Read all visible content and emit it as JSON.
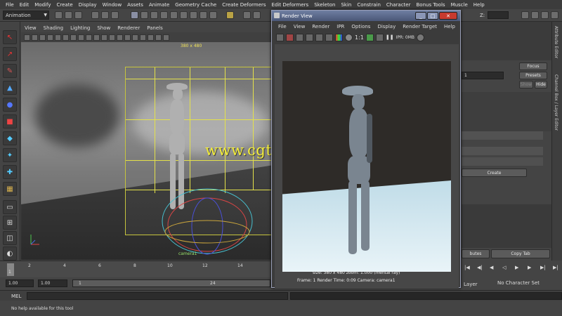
{
  "main_menu": [
    "File",
    "Edit",
    "Modify",
    "Create",
    "Display",
    "Window",
    "Assets",
    "Animate",
    "Geometry Cache",
    "Create Deformers",
    "Edit Deformers",
    "Skeleton",
    "Skin",
    "Constrain",
    "Character",
    "Bonus Tools",
    "Muscle",
    "Help"
  ],
  "status_line": {
    "mode": "Animation",
    "z_label": "Z:"
  },
  "viewport": {
    "menu": [
      "View",
      "Shading",
      "Lighting",
      "Show",
      "Renderer",
      "Panels"
    ],
    "resolution_label": "380 x 480",
    "camera_label": "camera1"
  },
  "render_view": {
    "title": "Render View",
    "menu": [
      "File",
      "View",
      "Render",
      "IPR",
      "Options",
      "Display",
      "Render Target",
      "Help"
    ],
    "toolbar_ratio": "1:1",
    "ipr_label": "IPR: 0MB",
    "info_line1": "size: 380 x 480  zoom: 1.000      (mental ray)",
    "info_line2": "Frame: 1      Render Time: 0:09      Camera: camera1"
  },
  "right_panel": {
    "field_value": "1",
    "focus_button": "Focus",
    "presets_button": "Presets",
    "show_button": "Show",
    "hide_button": "Hide",
    "create_button": "Create",
    "attributes_tab": "butes",
    "copy_tab_button": "Copy Tab",
    "layer_label": "Layer",
    "character_set": "No Character Set"
  },
  "side_tabs": {
    "attribute_editor": "Attribute Editor",
    "channel_box": "Channel Box / Layer Editor"
  },
  "timeline": {
    "ticks": [
      "1",
      "2",
      "4",
      "6",
      "8",
      "10",
      "12",
      "14"
    ],
    "current_frame": "1"
  },
  "range": {
    "start": "1.00",
    "playback_start": "1.00",
    "range_start": "1",
    "range_end": "24"
  },
  "command_line": {
    "label": "MEL"
  },
  "help_line": {
    "text": "No help available for this tool"
  },
  "watermark": "www.cgtsj.com",
  "colors": {
    "grid": "#e4e14a",
    "watermark": "#f5ef3a",
    "title_bar": "#5a6a8e",
    "camera_label": "#9ae36c"
  }
}
